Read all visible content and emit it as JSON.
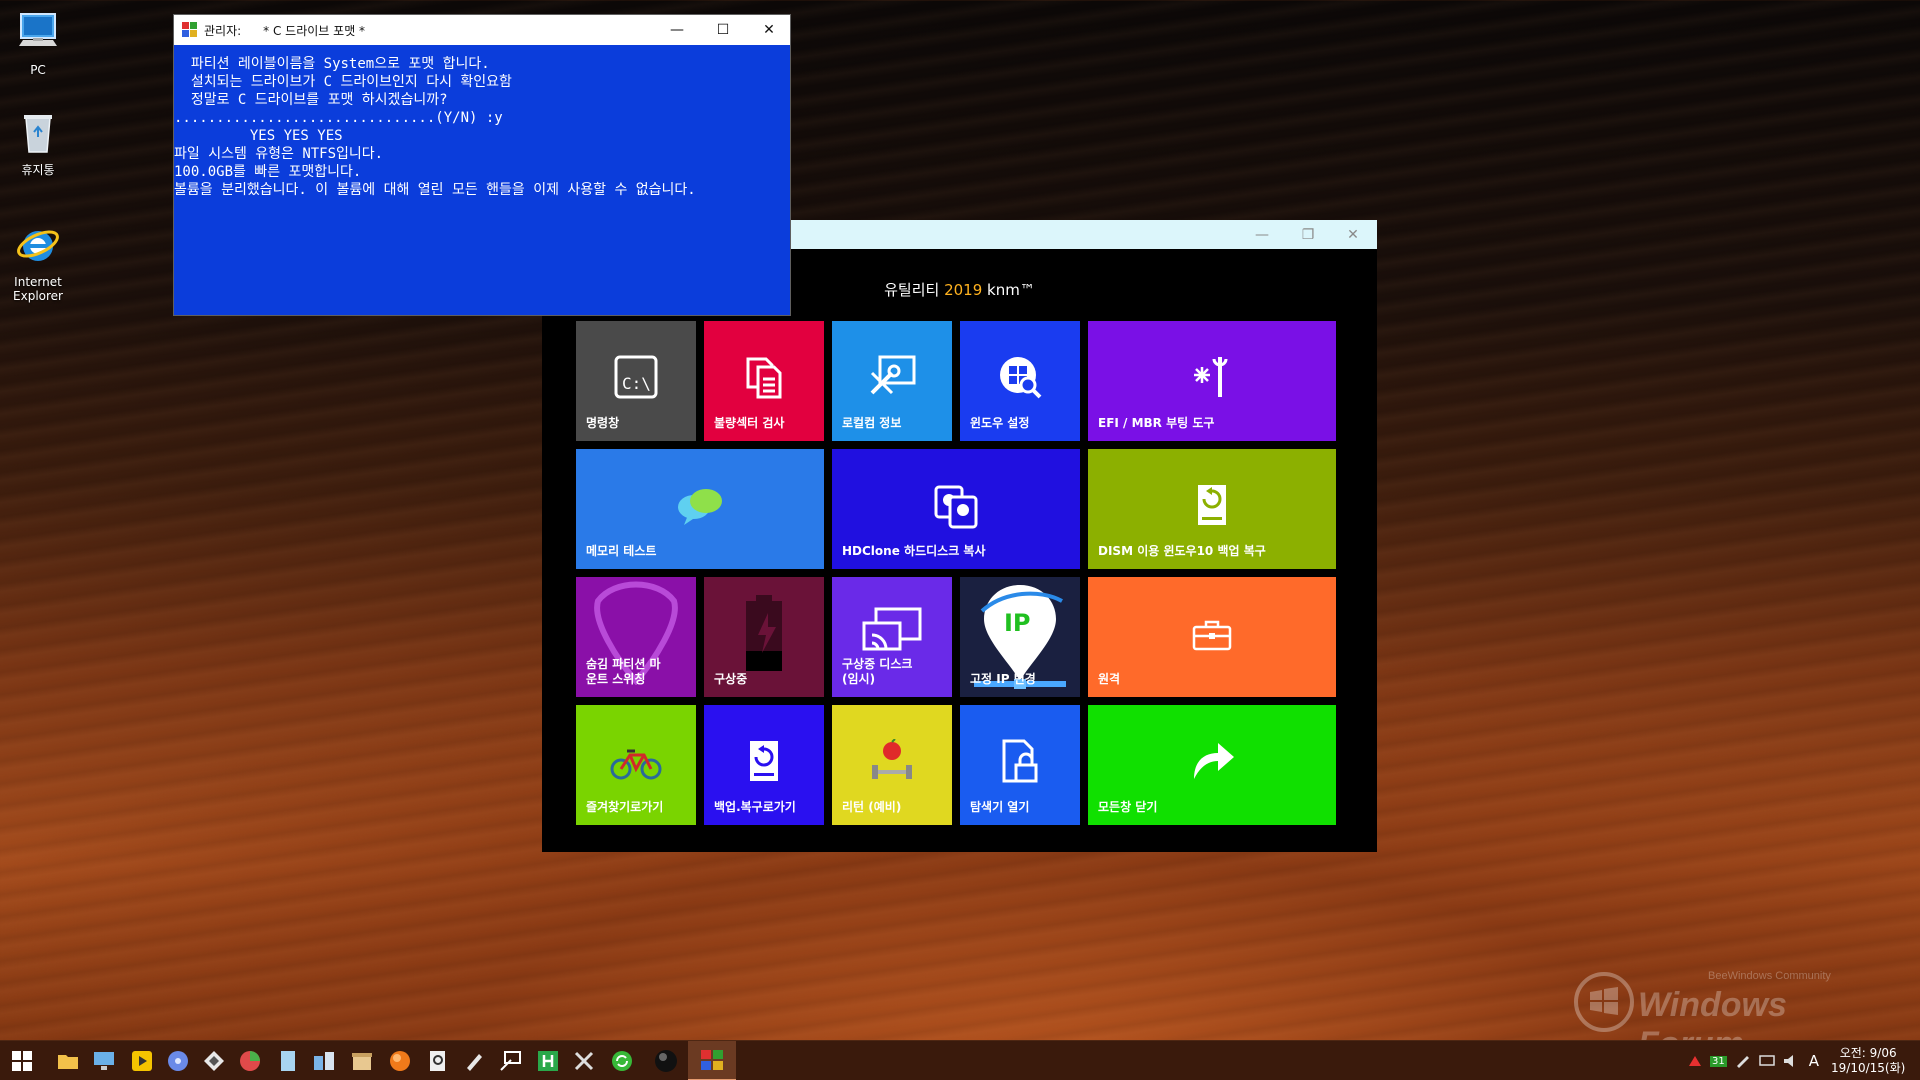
{
  "desktop": {
    "icons": [
      {
        "label": "PC"
      },
      {
        "label": "휴지통"
      },
      {
        "label": "Internet\nExplorer"
      }
    ]
  },
  "cmd_window": {
    "title_prefix": "관리자:",
    "title": "* C 드라이브 포맷 *",
    "lines": [
      "  파티션 레이블이름을 System으로 포맷 합니다.",
      "",
      "  설치되는 드라이브가 C 드라이브인지 다시 확인요함",
      "",
      "  정말로 C 드라이브를 포맷 하시겠습니까?",
      "",
      "...............................(Y/N) :y",
      "         YES YES YES",
      "",
      "파일 시스템 유형은 NTFS입니다.",
      "100.0GB를 빠른 포맷합니다.",
      "볼륨을 분리했습니다. 이 볼륨에 대해 열린 모든 핸들을 이제 사용할 수 없습니다."
    ],
    "controls": {
      "minimize": "—",
      "maximize": "☐",
      "close": "✕"
    }
  },
  "utility_window": {
    "title_main": "유틸리티 ",
    "title_year": "2019",
    "title_suffix": " knm™",
    "controls": {
      "minimize": "—",
      "restore": "❐",
      "close": "✕"
    },
    "tiles": [
      {
        "label": "명령창",
        "color": "#4a4a4a",
        "icon": "terminal-icon"
      },
      {
        "label": "불량섹터 검사",
        "color": "#e2003f",
        "icon": "documents-icon"
      },
      {
        "label": "로컬컴 정보",
        "color": "#1e90e8",
        "icon": "tools-monitor-icon"
      },
      {
        "label": "윈도우 설정",
        "color": "#1a3cf0",
        "icon": "windows-search-icon"
      },
      {
        "label": "EFI / MBR 부팅 도구",
        "color": "#7a10e6",
        "icon": "wrench-spark-icon"
      },
      {
        "label": "메모리 테스트",
        "color": "#2a7ae8",
        "icon": "chat-bubbles-icon"
      },
      {
        "label": "HDClone 하드디스크 복사",
        "color": "#2010e0",
        "icon": "disk-clone-icon"
      },
      {
        "label": "DISM 이용 윈도우10 백업 복구",
        "color": "#8cb000",
        "icon": "backup-drive-icon"
      },
      {
        "label": "숨김 파티션 마\n운트 스위칭",
        "color": "#8a10a8",
        "icon": "pick-icon"
      },
      {
        "label": "구상중",
        "color": "#6a1238",
        "icon": "battery-icon"
      },
      {
        "label": "구상중 디스크\n(임시)",
        "color": "#6a2ae8",
        "icon": "cast-screen-icon"
      },
      {
        "label": "고정 IP 변경",
        "color": "#1a2040",
        "icon": "ip-pin-icon",
        "ip_text": "IP"
      },
      {
        "label": "원격",
        "color": "#ff6a2a",
        "icon": "briefcase-icon"
      },
      {
        "label": "즐겨찾기로가기",
        "color": "#7ad400",
        "icon": "bicycle-icon"
      },
      {
        "label": "백업.복구로가기",
        "color": "#2a10f0",
        "icon": "restore-drive-icon"
      },
      {
        "label": "리턴 (예비)",
        "color": "#e0d820",
        "icon": "fitness-icon"
      },
      {
        "label": "탐색기 열기",
        "color": "#1a5cf0",
        "icon": "lock-doc-icon"
      },
      {
        "label": "모든창 닫기",
        "color": "#10e000",
        "icon": "share-arrow-icon"
      }
    ]
  },
  "taskbar": {
    "clock_time": "오전: 9/06",
    "clock_date": "19/10/15(화)",
    "tray_calendar": "31",
    "tray_ime": "A"
  },
  "watermark": {
    "text": "Windows Forum",
    "subtext": "BeeWindows Community"
  }
}
